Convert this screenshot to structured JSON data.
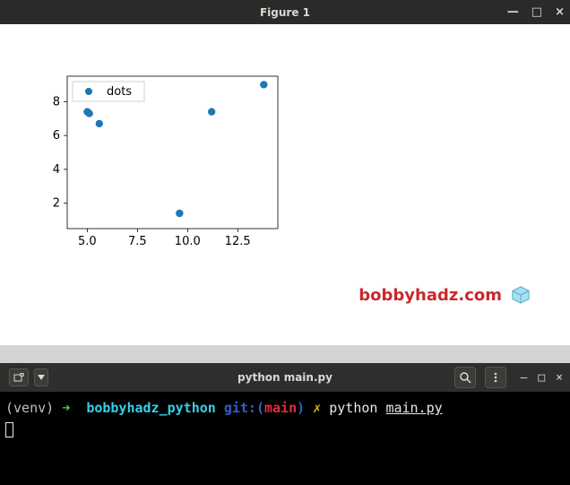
{
  "figure": {
    "title": "Figure 1"
  },
  "chart_data": {
    "type": "scatter",
    "series": [
      {
        "name": "dots",
        "x": [
          5.0,
          5.1,
          5.6,
          9.6,
          11.2,
          13.8
        ],
        "y": [
          7.4,
          7.3,
          6.7,
          1.4,
          7.4,
          9.0
        ]
      }
    ],
    "xlim": [
      4.0,
      14.5
    ],
    "ylim": [
      0.5,
      9.5
    ],
    "xticks": [
      5.0,
      7.5,
      10.0,
      12.5
    ],
    "yticks": [
      2,
      4,
      6,
      8
    ],
    "xtick_labels": [
      "5.0",
      "7.5",
      "10.0",
      "12.5"
    ],
    "ytick_labels": [
      "2",
      "4",
      "6",
      "8"
    ],
    "legend": {
      "entries": [
        "dots"
      ],
      "loc": "upper left"
    }
  },
  "brand": {
    "text": "bobbyhadz.com"
  },
  "terminal": {
    "title": "python main.py",
    "prompt": {
      "env": "(venv)",
      "arrow": "➜",
      "dir": "bobbyhadz_python",
      "git_label": "git:(",
      "branch": "main",
      "git_close": ")",
      "dirty": "✗",
      "cmd_bin": "python",
      "cmd_arg": "main.py"
    }
  }
}
